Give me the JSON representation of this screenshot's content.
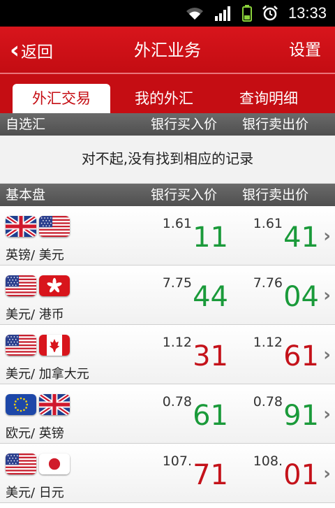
{
  "status": {
    "time": "13:33"
  },
  "header": {
    "back_label": "返回",
    "title": "外汇业务",
    "settings_label": "设置"
  },
  "tabs": [
    {
      "label": "外汇交易"
    },
    {
      "label": "我的外汇"
    },
    {
      "label": "查询明细"
    }
  ],
  "watchlist": {
    "header": {
      "name": "自选汇",
      "buy": "银行买入价",
      "sell": "银行卖出价"
    },
    "empty_message": "对不起,没有找到相应的记录"
  },
  "basic": {
    "header": {
      "name": "基本盘",
      "buy": "银行买入价",
      "sell": "银行卖出价"
    },
    "rows": [
      {
        "pair": "英镑/ 美元",
        "flags": [
          "uk-flag",
          "us-flag"
        ],
        "buy_prefix": "1.61",
        "buy_main": "11",
        "buy_color": "#1a9a3a",
        "sell_prefix": "1.61",
        "sell_main": "41",
        "sell_color": "#1a9a3a"
      },
      {
        "pair": "美元/ 港币",
        "flags": [
          "us-flag",
          "hk-flag"
        ],
        "buy_prefix": "7.75",
        "buy_main": "44",
        "buy_color": "#1a9a3a",
        "sell_prefix": "7.76",
        "sell_main": "04",
        "sell_color": "#1a9a3a"
      },
      {
        "pair": "美元/ 加拿大元",
        "flags": [
          "us-flag",
          "ca-flag"
        ],
        "buy_prefix": "1.12",
        "buy_main": "31",
        "buy_color": "#c4121a",
        "sell_prefix": "1.12",
        "sell_main": "61",
        "sell_color": "#c4121a"
      },
      {
        "pair": "欧元/ 英镑",
        "flags": [
          "eu-flag",
          "uk-flag"
        ],
        "buy_prefix": "0.78",
        "buy_main": "61",
        "buy_color": "#1a9a3a",
        "sell_prefix": "0.78",
        "sell_main": "91",
        "sell_color": "#1a9a3a"
      },
      {
        "pair": "美元/ 日元",
        "flags": [
          "us-flag",
          "jp-flag"
        ],
        "buy_prefix": "107.",
        "buy_main": "71",
        "buy_color": "#c4121a",
        "sell_prefix": "108.",
        "sell_main": "01",
        "sell_color": "#c4121a"
      }
    ]
  }
}
